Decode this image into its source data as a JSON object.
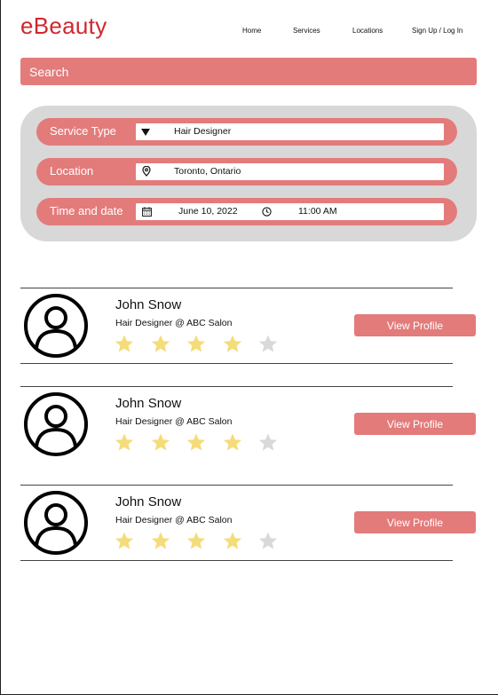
{
  "header": {
    "logo": "eBeauty",
    "nav": [
      "Home",
      "Services",
      "Locations",
      "Sign Up / Log In"
    ]
  },
  "search": {
    "placeholder": "Search"
  },
  "filters": {
    "service_type": {
      "label": "Service Type",
      "value": "Hair Designer",
      "icon": "dropdown-triangle-icon"
    },
    "location": {
      "label": "Location",
      "value": "Toronto, Ontario",
      "icon": "location-pin-icon"
    },
    "time_and_date": {
      "label": "Time and date",
      "date": "June 10, 2022",
      "time": "11:00 AM",
      "date_icon": "calendar-icon",
      "time_icon": "clock-icon"
    }
  },
  "results": [
    {
      "name": "John Snow",
      "role": "Hair Designer @ ABC Salon",
      "rating": 4,
      "max_rating": 5,
      "button": "View Profile"
    },
    {
      "name": "John Snow",
      "role": "Hair Designer @ ABC Salon",
      "rating": 4,
      "max_rating": 5,
      "button": "View Profile"
    },
    {
      "name": "John Snow",
      "role": "Hair Designer @ ABC Salon",
      "rating": 4,
      "max_rating": 5,
      "button": "View Profile"
    }
  ],
  "colors": {
    "brand": "#d0272f",
    "accent": "#e37b7b",
    "panel": "#d8d8d8",
    "star_filled": "#f5dc7a",
    "star_empty": "#d9d9d9"
  }
}
